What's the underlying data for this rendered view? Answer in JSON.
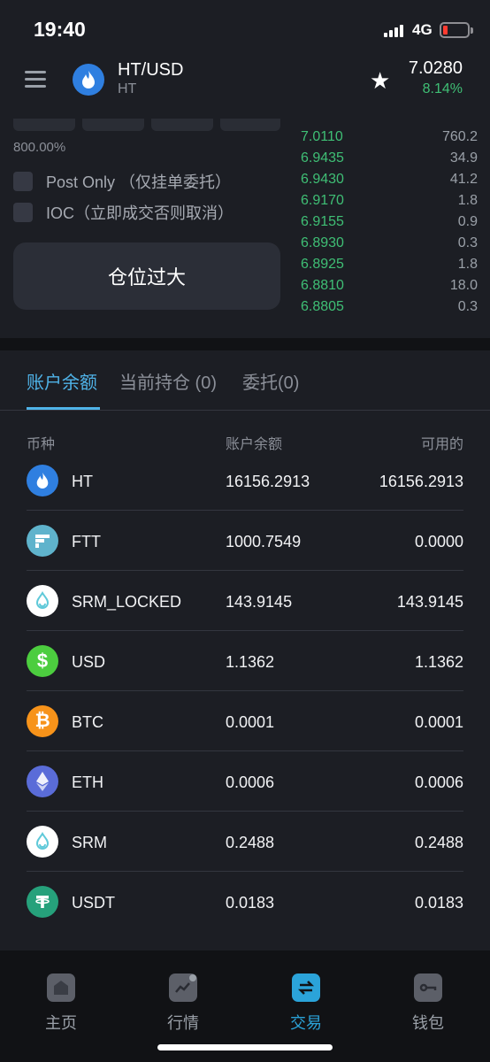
{
  "status_bar": {
    "time": "19:40",
    "network": "4G"
  },
  "header": {
    "pair": "HT/USD",
    "base": "HT",
    "price": "7.0280",
    "change": "8.14%",
    "colors": {
      "up": "#3fbf75",
      "background": "#1c1e24"
    }
  },
  "order_form": {
    "leverage": "800.00%",
    "post_only_label": "Post Only （仅挂单委托）",
    "ioc_label": "IOC（立即成交否则取消）",
    "submit_label": "仓位过大"
  },
  "order_book": [
    {
      "price": "7.0110",
      "qty": "760.2"
    },
    {
      "price": "6.9435",
      "qty": "34.9"
    },
    {
      "price": "6.9430",
      "qty": "41.2"
    },
    {
      "price": "6.9170",
      "qty": "1.8"
    },
    {
      "price": "6.9155",
      "qty": "0.9"
    },
    {
      "price": "6.8930",
      "qty": "0.3"
    },
    {
      "price": "6.8925",
      "qty": "1.8"
    },
    {
      "price": "6.8810",
      "qty": "18.0"
    },
    {
      "price": "6.8805",
      "qty": "0.3"
    }
  ],
  "account_tabs": {
    "balance": "账户余额",
    "positions": "当前持仓 (0)",
    "orders": "委托(0)",
    "active": "balance"
  },
  "columns": {
    "coin": "币种",
    "balance": "账户余额",
    "available": "可用的"
  },
  "assets": [
    {
      "symbol": "HT",
      "balance": "16156.2913",
      "available": "16156.2913",
      "icon": "huobi-flame-icon",
      "color": "#2f7fe0"
    },
    {
      "symbol": "FTT",
      "balance": "1000.7549",
      "available": "0.0000",
      "icon": "ftx-icon",
      "color": "#5fb3cc"
    },
    {
      "symbol": "SRM_LOCKED",
      "balance": "143.9145",
      "available": "143.9145",
      "icon": "serum-icon",
      "color": "#ffffff"
    },
    {
      "symbol": "USD",
      "balance": "1.1362",
      "available": "1.1362",
      "icon": "dollar-icon",
      "color": "#4ccd3f"
    },
    {
      "symbol": "BTC",
      "balance": "0.0001",
      "available": "0.0001",
      "icon": "bitcoin-icon",
      "color": "#f7931a"
    },
    {
      "symbol": "ETH",
      "balance": "0.0006",
      "available": "0.0006",
      "icon": "ethereum-icon",
      "color": "#5a6cd8"
    },
    {
      "symbol": "SRM",
      "balance": "0.2488",
      "available": "0.2488",
      "icon": "serum-icon",
      "color": "#ffffff"
    },
    {
      "symbol": "USDT",
      "balance": "0.0183",
      "available": "0.0183",
      "icon": "tether-icon",
      "color": "#26a17b"
    }
  ],
  "bottom_nav": [
    {
      "label": "主页",
      "icon": "home-icon"
    },
    {
      "label": "行情",
      "icon": "market-chart-icon"
    },
    {
      "label": "交易",
      "icon": "trade-swap-icon",
      "active": true
    },
    {
      "label": "钱包",
      "icon": "wallet-icon"
    }
  ]
}
